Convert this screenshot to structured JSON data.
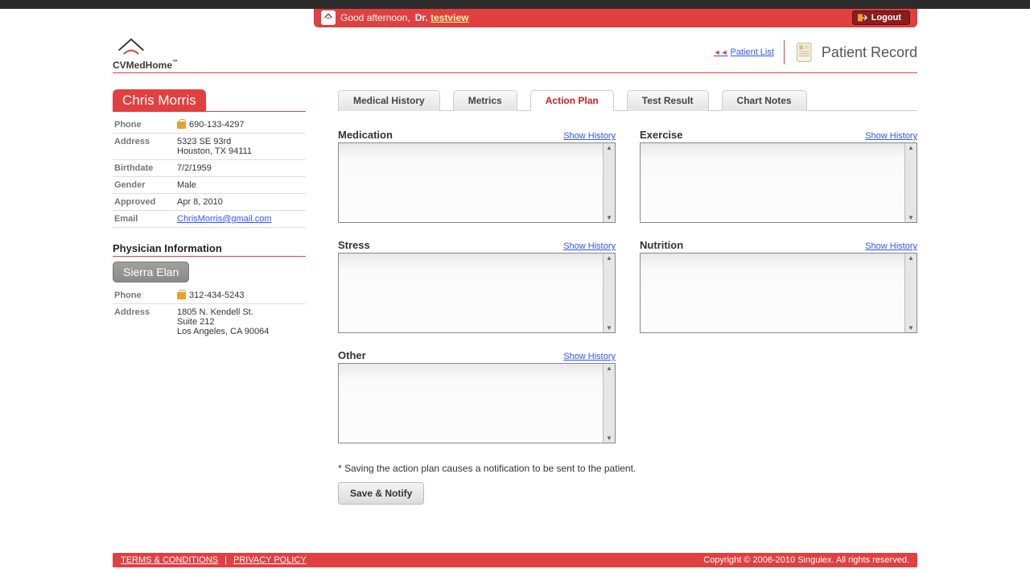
{
  "header": {
    "greeting": "Good afternoon,",
    "doctor_prefix": "Dr.",
    "username": "testview",
    "logout": "Logout",
    "logo": "CVMedHome",
    "patient_list": "Patient List",
    "page_title": "Patient Record"
  },
  "patient": {
    "name": "Chris Morris",
    "fields": [
      {
        "label": "Phone",
        "value": "690-133-4297",
        "icon": true
      },
      {
        "label": "Address",
        "value": "5323 SE 93rd\nHouston, TX 94111"
      },
      {
        "label": "Birthdate",
        "value": "7/2/1959"
      },
      {
        "label": "Gender",
        "value": "Male"
      },
      {
        "label": "Approved",
        "value": "Apr 8, 2010"
      },
      {
        "label": "Email",
        "value": "ChrisMorris@gmail.com",
        "link": true
      }
    ]
  },
  "physician": {
    "section_title": "Physician Information",
    "name": "Sierra Elan",
    "fields": [
      {
        "label": "Phone",
        "value": "312-434-5243",
        "icon": true
      },
      {
        "label": "Address",
        "value": "1805 N. Kendell St.\nSuite 212\nLos Angeles, CA 90064"
      }
    ]
  },
  "tabs": [
    "Medical History",
    "Metrics",
    "Action Plan",
    "Test Result",
    "Chart Notes"
  ],
  "active_tab": "Action Plan",
  "plan_sections": [
    {
      "title": "Medication",
      "link": "Show History"
    },
    {
      "title": "Exercise",
      "link": "Show History"
    },
    {
      "title": "Stress",
      "link": "Show History"
    },
    {
      "title": "Nutrition",
      "link": "Show History"
    },
    {
      "title": "Other",
      "link": "Show History"
    }
  ],
  "note": "* Saving the action plan causes a notification to be sent to the patient.",
  "save_label": "Save & Notify",
  "footer": {
    "terms": "TERMS & CONDITIONS",
    "privacy": "PRIVACY POLICY",
    "copyright": "Copyright © 2006-2010 Singulex. All rights reserved."
  }
}
